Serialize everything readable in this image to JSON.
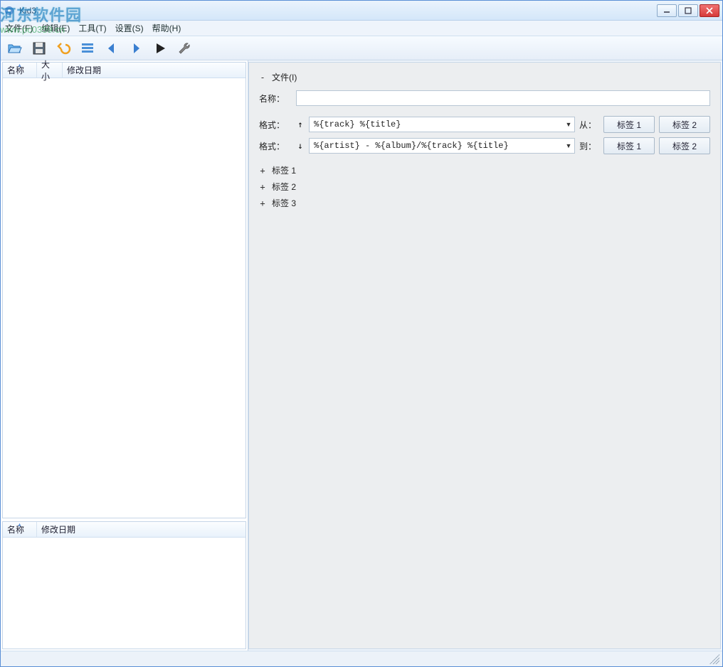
{
  "window": {
    "title": "Kid3"
  },
  "watermark": {
    "text": "河东软件园",
    "url": "www.pc0359.cn"
  },
  "menubar": [
    "文件(F)",
    "编辑(E)",
    "工具(T)",
    "设置(S)",
    "帮助(H)"
  ],
  "left": {
    "file_columns": [
      "名称",
      "大小",
      "修改日期"
    ],
    "dir_columns": [
      "名称",
      "修改日期"
    ]
  },
  "right": {
    "file_section": "文件(I)",
    "name_label": "名称：",
    "name_value": "",
    "format_label": "格式：",
    "format_from_value": "%{track} %{title}",
    "format_to_value": "%{artist} - %{album}/%{track} %{title}",
    "from_label": "从：",
    "to_label": "到：",
    "tag1_btn": "标签 1",
    "tag2_btn": "标签 2",
    "tags": [
      "标签 1",
      "标签 2",
      "标签 3"
    ]
  }
}
